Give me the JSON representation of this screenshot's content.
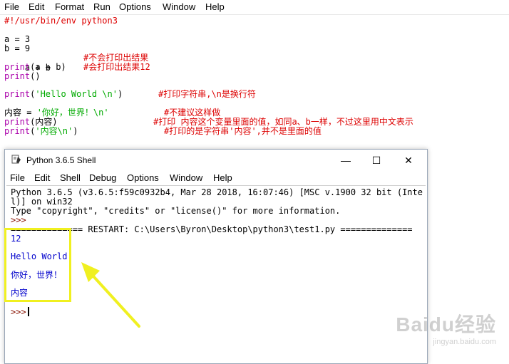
{
  "editor_menu": {
    "items": [
      "File",
      "Edit",
      "Format",
      "Run",
      "Options",
      "Window",
      "Help"
    ]
  },
  "editor": {
    "shebang": "#!/usr/bin/env python3",
    "l_a": "a = 3",
    "l_b": "b = 9",
    "l_ab": "a + b",
    "c_ab": "#不会打印出结果",
    "l_print_ab_kw": "print",
    "l_print_ab_rest": "(a + b)",
    "c_print_ab": "#会打印出结果12",
    "l_print_empty_kw": "print",
    "l_print_empty_rest": "()",
    "l_hello_kw": "print",
    "l_hello_open": "(",
    "l_hello_str": "'Hello World \\n'",
    "l_hello_close": ")",
    "c_hello": "#打印字符串,\\n是换行符",
    "l_neirong_var": "内容 = ",
    "l_neirong_str": "'你好，世界！\\n'",
    "c_neirong": "#不建议这样做",
    "l_print_neirong_kw": "print",
    "l_print_neirong_rest": "(内容)",
    "c_print_neirong": "#打印 内容这个变量里面的值，如同a、b一样，不过这里用中文表示",
    "l_print_str_kw": "print",
    "l_print_str_open": "(",
    "l_print_str_str": "'内容\\n'",
    "l_print_str_close": ")",
    "c_print_str": "#打印的是字符串'内容',并不是里面的值"
  },
  "shell": {
    "title": "Python 3.6.5 Shell",
    "menu": [
      "File",
      "Edit",
      "Shell",
      "Debug",
      "Options",
      "Window",
      "Help"
    ],
    "buttons": {
      "minimize": "—",
      "maximize": "☐",
      "close": "✕"
    },
    "banner1": "Python 3.6.5 (v3.6.5:f59c0932b4, Mar 28 2018, 16:07:46) [MSC v.1900 32 bit (Inte",
    "banner2": "l)] on win32",
    "banner3": "Type \"copyright\", \"credits\" or \"license()\" for more information.",
    "prompt": ">>>",
    "restart": "============== RESTART: C:\\Users\\Byron\\Desktop\\python3\\test1.py ==============",
    "out1": "12",
    "out2": "Hello World",
    "out3": "你好，世界！",
    "out4": "内容",
    "prompt_final": ">>>"
  },
  "watermark": {
    "main": "Baidu经验",
    "sub": "jingyan.baidu.com"
  },
  "colors": {
    "keyword": "#aa00aa",
    "string": "#00aa00",
    "comment": "#dd0000",
    "output": "#0000cc",
    "highlight": "#f0f020",
    "arrow": "#f0f020"
  }
}
